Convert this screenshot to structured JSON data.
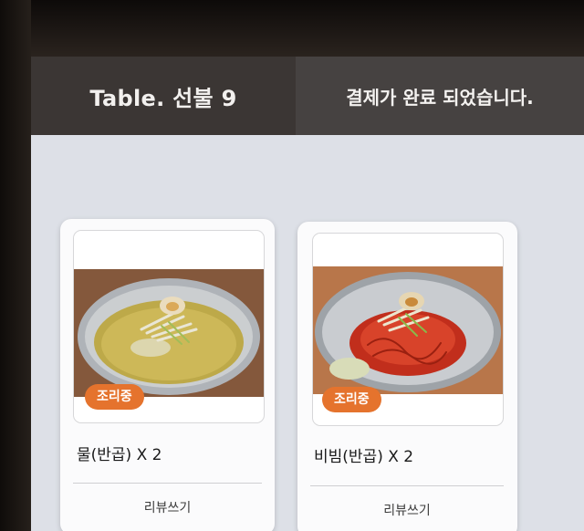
{
  "header": {
    "table_title": "Table. 선불 9",
    "payment_message": "결제가 완료 되었습니다."
  },
  "orders": [
    {
      "status_badge": "조리중",
      "item_name": "물(반곱) X 2",
      "review_label": "리뷰쓰기"
    },
    {
      "status_badge": "조리중",
      "item_name": "비빔(반곱) X 2",
      "review_label": "리뷰쓰기"
    }
  ],
  "colors": {
    "header_left": "#3b3634",
    "header_right": "#464241",
    "status_badge": "#e5732d",
    "content_bg": "#dde0e7"
  }
}
